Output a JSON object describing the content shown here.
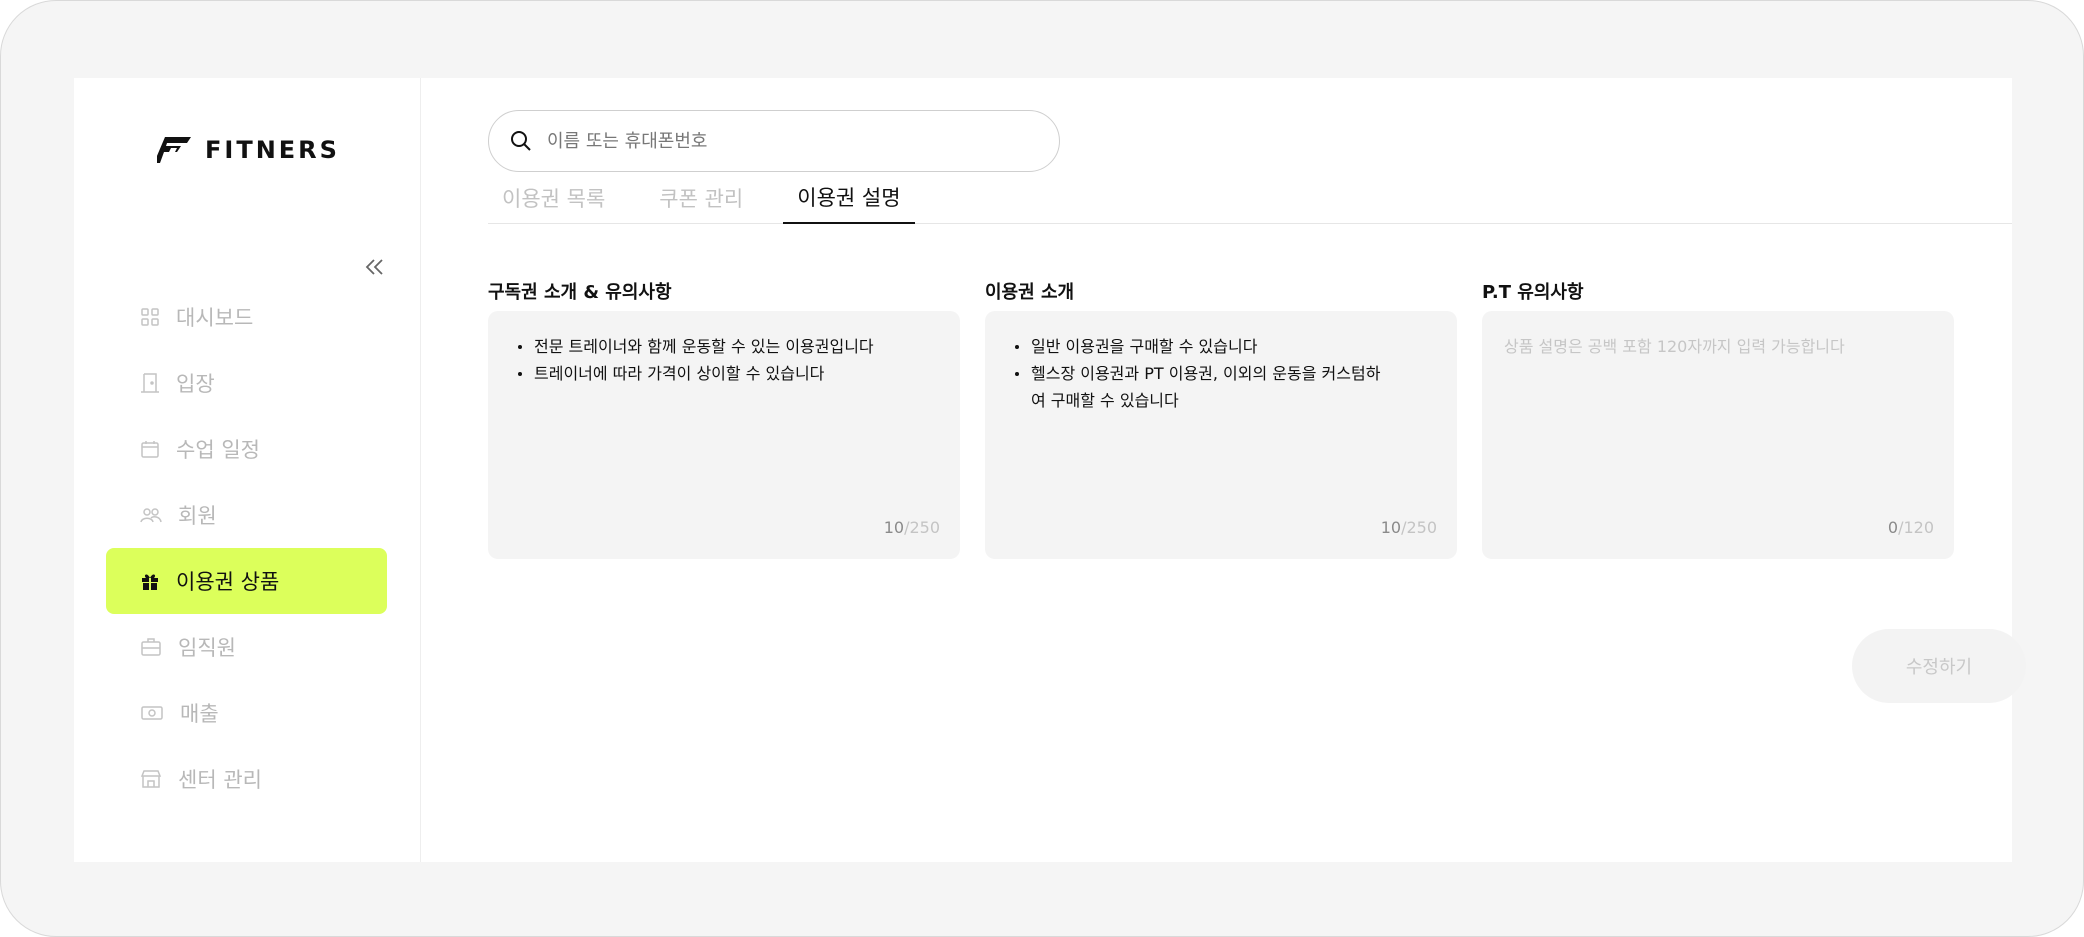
{
  "brand": {
    "name": "FITNERS",
    "accent_color": "#dcff5b"
  },
  "sidebar": {
    "collapse_icon": "double-chevron-left-icon",
    "items": [
      {
        "label": "대시보드",
        "icon": "grid-icon",
        "active": false
      },
      {
        "label": "입장",
        "icon": "door-icon",
        "active": false
      },
      {
        "label": "수업 일정",
        "icon": "calendar-icon",
        "active": false
      },
      {
        "label": "회원",
        "icon": "members-icon",
        "active": false
      },
      {
        "label": "이용권 상품",
        "icon": "gift-icon",
        "active": true
      },
      {
        "label": "임직원",
        "icon": "briefcase-icon",
        "active": false
      },
      {
        "label": "매출",
        "icon": "cash-icon",
        "active": false
      },
      {
        "label": "센터 관리",
        "icon": "store-icon",
        "active": false
      }
    ]
  },
  "search": {
    "placeholder": "이름 또는 휴대폰번호",
    "value": "",
    "icon": "search-icon"
  },
  "tabs": [
    {
      "label": "이용권 목록",
      "active": false
    },
    {
      "label": "쿠폰 관리",
      "active": false
    },
    {
      "label": "이용권 설명",
      "active": true
    }
  ],
  "cards": [
    {
      "title": "구독권 소개 & 유의사항",
      "bullets": [
        "전문 트레이너와 함께 운동할 수 있는 이용권입니다",
        "트레이너에 따라 가격이 상이할 수 있습니다"
      ],
      "count": "10",
      "max": "/250"
    },
    {
      "title": "이용권 소개",
      "bullets": [
        "일반 이용권을 구매할 수 있습니다",
        "헬스장 이용권과 PT 이용권, 이외의 운동을 커스텀하여 구매할 수 있습니다"
      ],
      "count": "10",
      "max": "/250"
    },
    {
      "title": "P.T 유의사항",
      "placeholder": "상품 설명은 공백 포함 120자까지 입력 가능합니다",
      "count": "0",
      "max": "/120"
    }
  ],
  "submit_label": "수정하기"
}
